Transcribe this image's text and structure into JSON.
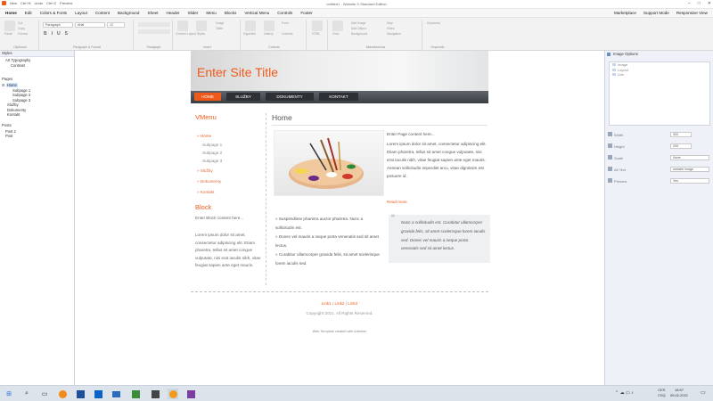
{
  "titlebar": {
    "quick_items": [
      "New",
      "Ctrl+N",
      "Undo",
      "Ctrl+Z",
      "Preview"
    ],
    "title": "untitled1 - Website X Standard Edition",
    "buttons": [
      "–",
      "□",
      "✕"
    ]
  },
  "menubar": {
    "items": [
      "Home",
      "Edit",
      "Colors & Fonts",
      "Layout",
      "Content",
      "Background",
      "Sheet",
      "Header",
      "Slider",
      "Menu",
      "Blocks",
      "Vertical Menu",
      "Controls",
      "Footer"
    ],
    "right_items": [
      "Marketplace",
      "Support Mode",
      "Responsive View"
    ]
  },
  "ribbon": {
    "groups": [
      "Clipboard",
      "Paragraph & Format",
      "Paragraph",
      "Insert",
      "Controls",
      "",
      "Miscellaneous",
      "Keywords"
    ],
    "font_combo": "Paragraph",
    "font_family": "Arial",
    "font_size": "12",
    "labels": {
      "paste": "Paste",
      "cut": "Cut",
      "copy": "Copy",
      "format": "Format",
      "content_layout": "Content Layout",
      "styles": "Styles",
      "image": "Image",
      "table": "Table",
      "hyperlink": "Hyperlink",
      "gallery": "Gallery",
      "form": "Form",
      "controls": "Controls",
      "html": "HTML",
      "view": "View",
      "add_image": "Add Image",
      "add_object": "Add Object",
      "background": "Background",
      "map": "Map",
      "video": "Video",
      "navigation": "Navigation",
      "keywords": "Keywords"
    }
  },
  "left_panel": {
    "styles_title": "Styles",
    "styles_items": [
      "Art Typography",
      "Contrast"
    ],
    "pages_title": "Pages",
    "pages_items": [
      "Home",
      "Subpage 1",
      "Subpage 2",
      "Subpage 3",
      "Služby",
      "Dokumenty",
      "Kontakt"
    ],
    "posts_title": "Posts",
    "posts_items": [
      "Post 2",
      "Post"
    ]
  },
  "site": {
    "title": "Enter Site Title",
    "nav": [
      "HOME",
      "SLUŽBY",
      "DOKUMENTY",
      "KONTAKT"
    ],
    "sidebar": {
      "vmenu_title": "VMenu",
      "home": "Home",
      "subpages": [
        "Subpage 1",
        "Subpage 2",
        "Subpage 3"
      ],
      "sluzby": "Služby",
      "dokumenty": "Dokumenty",
      "kontakt": "Kontakt",
      "block_title": "Block",
      "block_content": "Enter Block content here...",
      "lorem": "Lorem ipsum dolor sit amet, consectetur adipiscing elit. Etiam pharetra, tellus sit amet congue vulputate, nisi erat iaculis nibh, vitae feugiat sapien ante eget mauris."
    },
    "main": {
      "heading": "Home",
      "enter_text": "Enter Page content here...",
      "body": "Lorem ipsum dolor sit amet, consectetur adipiscing elit. Etiam pharetra, tellus sit amet congue vulputate, nisi erat iaculis nibh, vitae feugiat sapien ante eget mauris. Aenean sollicitudin imperdiet arcu, vitae dignissim est posuere id.",
      "read_more": "Read more",
      "bullets": [
        "Suspendisse pharetra auctor pharetra. Nunc a sollicitudin est.",
        "Donec vel mauris a neque porta venenatis sed sit amet lectus.",
        "Curabitur ullamcorper gravida felis, sit amet scelerisque lorem iaculis sed."
      ],
      "quote": "Nunc a sollicitudin est. Curabitur ullamcorper gravida felis, sit amet scelerisque lorem iaculis sed. Donec vel mauris a neque porta venenatis sed sit amet lectus."
    },
    "footer": {
      "links": [
        "Link1",
        "Link2",
        "Link3"
      ],
      "copyright": "Copyright 2021. All Rights Reserved.",
      "credit": "Web Template created with Artisteer"
    }
  },
  "right_panel": {
    "title": "Image Options",
    "list_items": [
      "Image",
      "Layout",
      "Link"
    ],
    "props": [
      {
        "label": "Width",
        "value": "300"
      },
      {
        "label": "Height",
        "value": "200"
      },
      {
        "label": "Scale",
        "value": "None"
      },
      {
        "label": "Alt Text",
        "value": "website image"
      },
      {
        "label": "Preview",
        "value": "Yes"
      }
    ]
  },
  "taskbar": {
    "tray_text": [
      "CES",
      "CSQ"
    ],
    "time": "18:57",
    "date": "05.02.2021"
  },
  "colors": {
    "accent": "#ef5a1a",
    "nav_dark": "#3a3e43",
    "panel_blue": "#eef2f8"
  }
}
